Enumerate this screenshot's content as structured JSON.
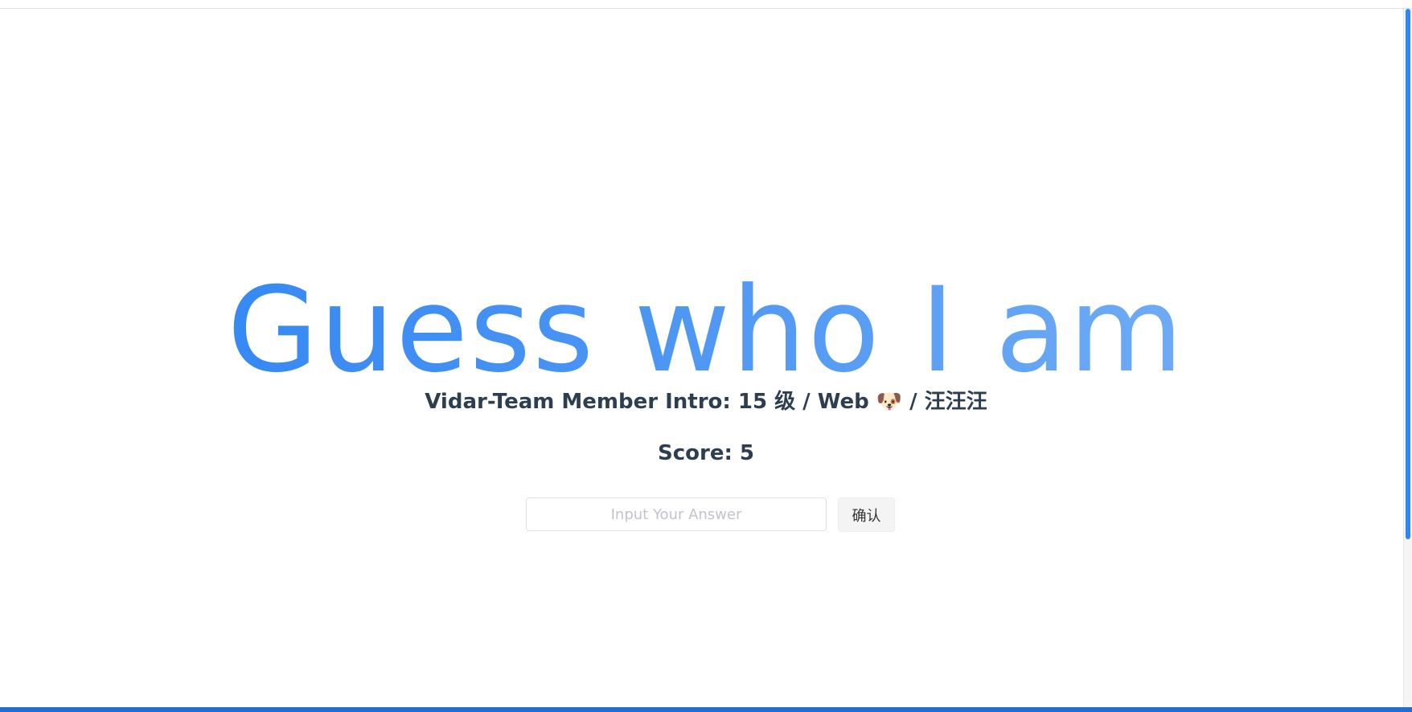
{
  "page": {
    "title": "Guess who I am",
    "intro": "Vidar-Team Member Intro: 15 级 / Web 🐶 / 汪汪汪",
    "score": "Score: 5"
  },
  "answer": {
    "placeholder": "Input Your Answer",
    "value": ""
  },
  "actions": {
    "confirm_label": "确认"
  },
  "colors": {
    "title_start": "#2b82f3",
    "title_end": "#7db4f6",
    "text": "#2c3e50"
  }
}
